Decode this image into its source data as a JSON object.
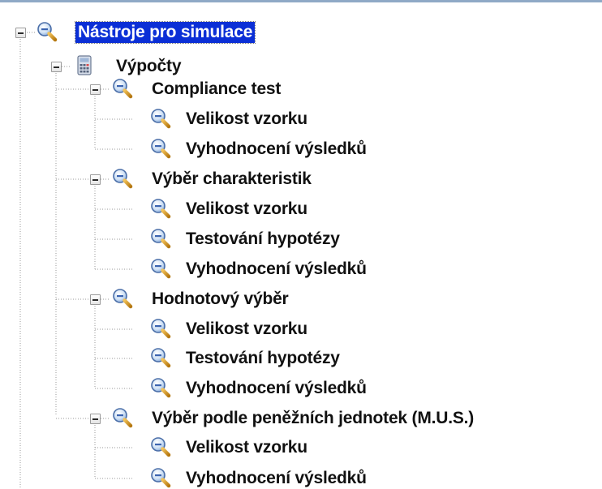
{
  "tree": {
    "root": {
      "label": "Nástroje pro simulace",
      "child": {
        "label": "Výpočty",
        "groups": [
          {
            "label": "Compliance test",
            "items": [
              "Velikost vzorku",
              "Vyhodnocení výsledků"
            ]
          },
          {
            "label": "Výběr charakteristik",
            "items": [
              "Velikost vzorku",
              "Testování hypotézy",
              "Vyhodnocení výsledků"
            ]
          },
          {
            "label": "Hodnotový výběr",
            "items": [
              "Velikost vzorku",
              "Testování hypotézy",
              "Vyhodnocení výsledků"
            ]
          },
          {
            "label": "Výběr podle peněžních jednotek (M.U.S.)",
            "items": [
              "Velikost vzorku",
              "Vyhodnocení výsledků"
            ]
          }
        ]
      }
    }
  },
  "colors": {
    "selection": "#0b2fd6",
    "tree_line": "#9a9a9a"
  },
  "icons": {
    "root": "magnifier-icon",
    "calculations": "calculator-icon",
    "group": "magnifier-icon",
    "item": "magnifier-icon"
  }
}
